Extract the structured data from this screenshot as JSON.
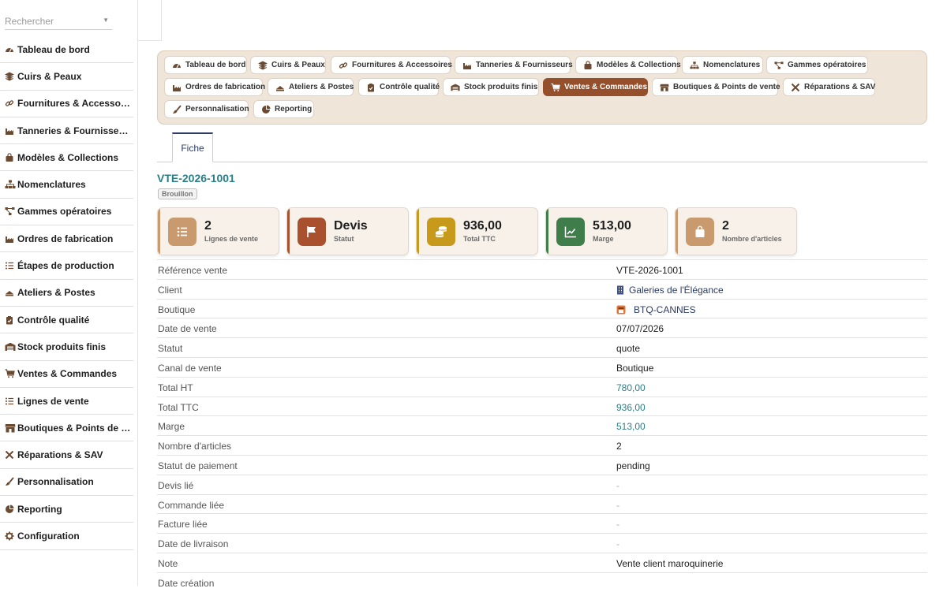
{
  "sidebar": {
    "search_placeholder": "Rechercher",
    "items": [
      {
        "label": "Tableau de bord",
        "icon": "dashboard-icon"
      },
      {
        "label": "Cuirs & Peaux",
        "icon": "layers-icon"
      },
      {
        "label": "Fournitures & Accessoires",
        "icon": "link-icon"
      },
      {
        "label": "Tanneries & Fournisseurs",
        "icon": "factory-icon"
      },
      {
        "label": "Modèles & Collections",
        "icon": "bag-icon"
      },
      {
        "label": "Nomenclatures",
        "icon": "sitemap-icon"
      },
      {
        "label": "Gammes opératoires",
        "icon": "flow-icon"
      },
      {
        "label": "Ordres de fabrication",
        "icon": "factory-icon"
      },
      {
        "label": "Étapes de production",
        "icon": "list-icon"
      },
      {
        "label": "Ateliers & Postes",
        "icon": "workshop-icon"
      },
      {
        "label": "Contrôle qualité",
        "icon": "clipboard-check-icon"
      },
      {
        "label": "Stock produits finis",
        "icon": "warehouse-icon"
      },
      {
        "label": "Ventes & Commandes",
        "icon": "cart-icon"
      },
      {
        "label": "Lignes de vente",
        "icon": "list-icon"
      },
      {
        "label": "Boutiques & Points de vente",
        "icon": "store-icon"
      },
      {
        "label": "Réparations & SAV",
        "icon": "tools-icon"
      },
      {
        "label": "Personnalisation",
        "icon": "brush-icon"
      },
      {
        "label": "Reporting",
        "icon": "pie-chart-icon"
      },
      {
        "label": "Configuration",
        "icon": "gear-icon"
      }
    ]
  },
  "module_nav": [
    {
      "label": "Tableau de bord",
      "icon": "dashboard-icon",
      "active": false
    },
    {
      "label": "Cuirs & Peaux",
      "icon": "layers-icon",
      "active": false
    },
    {
      "label": "Fournitures & Accessoires",
      "icon": "link-icon",
      "active": false
    },
    {
      "label": "Tanneries & Fournisseurs",
      "icon": "factory-icon",
      "active": false
    },
    {
      "label": "Modèles & Collections",
      "icon": "bag-icon",
      "active": false
    },
    {
      "label": "Nomenclatures",
      "icon": "sitemap-icon",
      "active": false
    },
    {
      "label": "Gammes opératoires",
      "icon": "flow-icon",
      "active": false
    },
    {
      "label": "Ordres de fabrication",
      "icon": "factory-icon",
      "active": false
    },
    {
      "label": "Ateliers & Postes",
      "icon": "workshop-icon",
      "active": false
    },
    {
      "label": "Contrôle qualité",
      "icon": "clipboard-check-icon",
      "active": false
    },
    {
      "label": "Stock produits finis",
      "icon": "warehouse-icon",
      "active": false
    },
    {
      "label": "Ventes & Commandes",
      "icon": "cart-icon",
      "active": true
    },
    {
      "label": "Boutiques & Points de vente",
      "icon": "store-icon",
      "active": false
    },
    {
      "label": "Réparations & SAV",
      "icon": "tools-icon",
      "active": false
    },
    {
      "label": "Personnalisation",
      "icon": "brush-icon",
      "active": false
    },
    {
      "label": "Reporting",
      "icon": "pie-chart-icon",
      "active": false
    }
  ],
  "tabs": {
    "fiche": "Fiche"
  },
  "record": {
    "title": "VTE-2026-1001",
    "status_badge": "Brouillon"
  },
  "stats": [
    {
      "value": "2",
      "label": "Lignes de vente",
      "icon": "list-icon",
      "color": "#c99a6e"
    },
    {
      "value": "Devis",
      "label": "Statut",
      "icon": "flag-icon",
      "color": "#a9502e"
    },
    {
      "value": "936,00",
      "label": "Total TTC",
      "icon": "coins-icon",
      "color": "#c79a1c"
    },
    {
      "value": "513,00",
      "label": "Marge",
      "icon": "chart-line-icon",
      "color": "#3f7d4a"
    },
    {
      "value": "2",
      "label": "Nombre d'articles",
      "icon": "shopping-bag-icon",
      "color": "#c99a6e"
    }
  ],
  "details": [
    {
      "label": "Référence vente",
      "value": "VTE-2026-1001",
      "type": "text"
    },
    {
      "label": "Client",
      "value": "Galeries de l'Élégance",
      "type": "link",
      "icon": "building-icon"
    },
    {
      "label": "Boutique",
      "value": "BTQ-CANNES",
      "type": "link",
      "icon": "store-icon"
    },
    {
      "label": "Date de vente",
      "value": "07/07/2026",
      "type": "text"
    },
    {
      "label": "Statut",
      "value": "quote",
      "type": "text"
    },
    {
      "label": "Canal de vente",
      "value": "Boutique",
      "type": "text"
    },
    {
      "label": "Total HT",
      "value": "780,00",
      "type": "num"
    },
    {
      "label": "Total TTC",
      "value": "936,00",
      "type": "num"
    },
    {
      "label": "Marge",
      "value": "513,00",
      "type": "num"
    },
    {
      "label": "Nombre d'articles",
      "value": "2",
      "type": "text"
    },
    {
      "label": "Statut de paiement",
      "value": "pending",
      "type": "text"
    },
    {
      "label": "Devis lié",
      "value": "-",
      "type": "dash"
    },
    {
      "label": "Commande liée",
      "value": "-",
      "type": "dash"
    },
    {
      "label": "Facture liée",
      "value": "-",
      "type": "dash"
    },
    {
      "label": "Date de livraison",
      "value": "-",
      "type": "dash"
    },
    {
      "label": "Note",
      "value": "Vente client maroquinerie",
      "type": "text"
    },
    {
      "label": "Date création",
      "value": "",
      "type": "text"
    }
  ]
}
